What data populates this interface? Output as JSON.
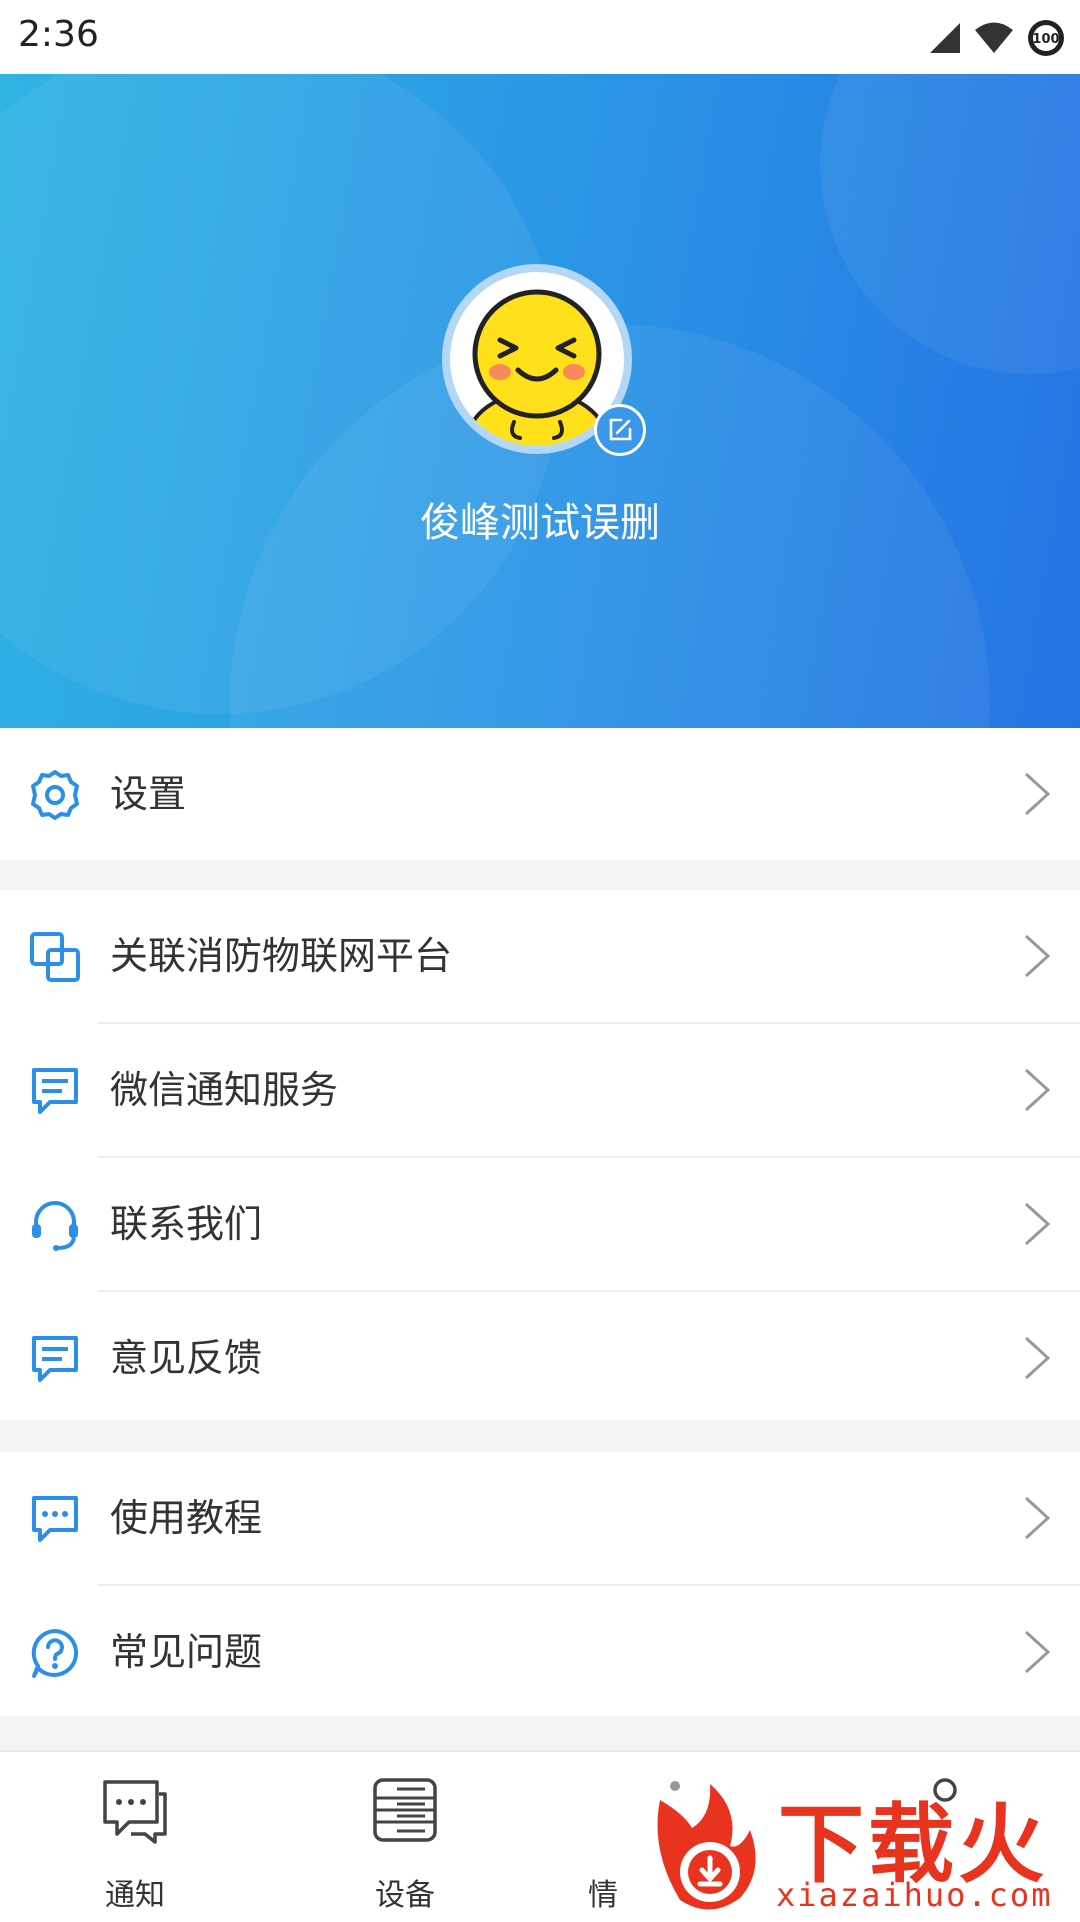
{
  "status_bar": {
    "time": "2:36",
    "battery": "100",
    "icons": [
      "cell-signal-icon",
      "wifi-icon",
      "battery-icon"
    ]
  },
  "profile": {
    "username": "俊峰测试误删",
    "avatar": "smiley-avatar",
    "edit_icon": "edit-icon"
  },
  "menu": {
    "settings": {
      "label": "设置",
      "icon": "gear-icon"
    },
    "link_platform": {
      "label": "关联消防物联网平台",
      "icon": "link-icon"
    },
    "wechat_notify": {
      "label": "微信通知服务",
      "icon": "message-icon"
    },
    "contact_us": {
      "label": "联系我们",
      "icon": "headset-icon"
    },
    "feedback": {
      "label": "意见反馈",
      "icon": "message-icon"
    },
    "tutorial": {
      "label": "使用教程",
      "icon": "chat-dots-icon"
    },
    "faq": {
      "label": "常见问题",
      "icon": "question-icon"
    }
  },
  "tabs": [
    {
      "label": "通知",
      "icon": "chat-bubbles-icon"
    },
    {
      "label": "设备",
      "icon": "device-list-icon"
    },
    {
      "label": "情",
      "icon": "info-icon"
    },
    {
      "label": "",
      "icon": "user-icon"
    }
  ],
  "watermark": {
    "text": "下载火",
    "url": "xiazaihuo.com"
  },
  "colors": {
    "header_start": "#2fb4e3",
    "header_end": "#2473e2",
    "icon_blue": "#2a8fe6",
    "watermark_red": "#e8331f"
  }
}
